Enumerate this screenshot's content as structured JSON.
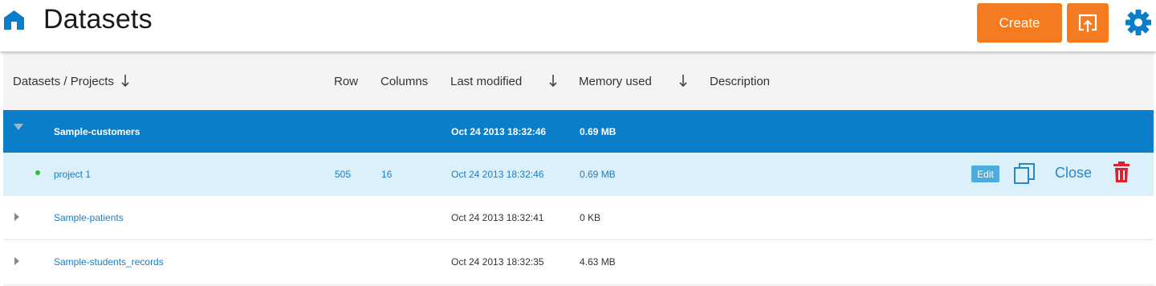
{
  "header": {
    "title": "Datasets",
    "create_label": "Create",
    "accent_color": "#f47b20",
    "brand_color": "#0a7ecb",
    "icons": [
      "home-icon",
      "upload-icon",
      "gear-icon"
    ]
  },
  "table": {
    "columns": {
      "name": "Datasets / Projects",
      "row": "Row",
      "columns": "Columns",
      "last_modified": "Last modified",
      "memory_used": "Memory used",
      "description": "Description"
    },
    "rows": [
      {
        "name": "Sample-customers",
        "row": "",
        "columns": "",
        "last_modified": "Oct 24 2013 18:32:46",
        "memory": "0.69 MB",
        "state": "expanded-selected"
      },
      {
        "name": "project 1",
        "row": "505",
        "columns": "16",
        "last_modified": "Oct 24 2013 18:32:46",
        "memory": "0.69 MB",
        "state": "child-active",
        "actions": {
          "edit_label": "Edit",
          "close_label": "Close"
        }
      },
      {
        "name": "Sample-patients",
        "row": "",
        "columns": "",
        "last_modified": "Oct 24 2013 18:32:41",
        "memory": "0 KB",
        "state": "collapsed"
      },
      {
        "name": "Sample-students_records",
        "row": "",
        "columns": "",
        "last_modified": "Oct 24 2013 18:32:35",
        "memory": "4.63 MB",
        "state": "collapsed"
      }
    ]
  }
}
